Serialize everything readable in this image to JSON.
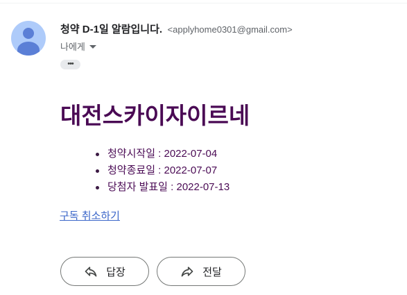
{
  "email": {
    "subject": "청약 D-1일 알람입니다.",
    "sender_email": "<applyhome0301@gmail.com>",
    "recipient_label": "나에게",
    "more_label": "•••"
  },
  "content": {
    "title": "대전스카이자이르네",
    "items": [
      "청약시작일 : 2022-07-04",
      "청약종료일 : 2022-07-07",
      "당첨자 발표일 : 2022-07-13"
    ],
    "unsubscribe_label": "구독 취소하기"
  },
  "actions": {
    "reply_label": "답장",
    "forward_label": "전달"
  },
  "colors": {
    "title": "#4a0a54",
    "link": "#3b66c9",
    "avatar_bg": "#aecbfa",
    "avatar_fg": "#5b7fd6"
  },
  "icons": {
    "avatar": "default-person-avatar",
    "recipient_dropdown": "caret-down-icon",
    "reply": "reply-arrow-icon",
    "forward": "forward-arrow-icon"
  }
}
